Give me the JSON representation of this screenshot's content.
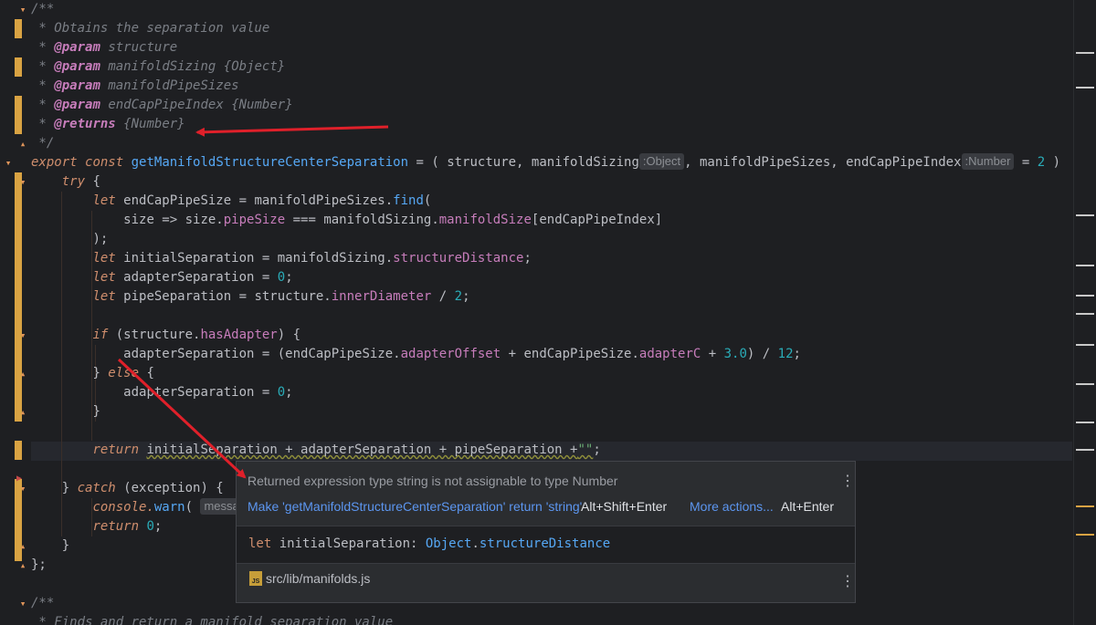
{
  "code": {
    "doc_open": "/**",
    "doc_desc": " * Obtains the separation value",
    "param_tag": "@param",
    "returns_tag": "@returns",
    "p1": "structure",
    "p2": "manifoldSizing",
    "p2_type": "{Object}",
    "p3": "manifoldPipeSizes",
    "p4": "endCapPipeIndex",
    "p4_type": "{Number}",
    "returns_type": "{Number}",
    "doc_close": " */",
    "export_kw": "export",
    "const_kw": "const",
    "func_name": "getManifoldStructureCenterSeparation",
    "sig_start": " = ( structure, manifoldSizing",
    "hint_object": ":Object",
    "sig_mid": ", manifoldPipeSizes, endCapPipeIndex",
    "hint_number": ":Number",
    "sig_end_a": " = ",
    "sig_end_num": "2",
    "sig_end_b": " )",
    "try_kw": "try",
    "let_kw": "let",
    "if_kw": "if",
    "else_kw": "else",
    "return_kw": "return",
    "catch_kw": "catch",
    "l_endcap": " endCapPipeSize = manifoldPipeSizes.",
    "find_fn": "find",
    "l_size": "size => size.",
    "pipeSize": "pipeSize",
    "l_size_b": " === manifoldSizing.",
    "manifoldSize": "manifoldSize",
    "l_size_c": "[endCapPipeIndex]",
    "close_paren": ");",
    "l_init": " initialSeparation = manifoldSizing.",
    "structureDistance": "structureDistance",
    "l_adapter": " adapterSeparation = ",
    "zero": "0",
    "l_pipe": " pipeSeparation = structure.",
    "innerDiameter": "innerDiameter",
    "l_pipe_b": " / ",
    "two": "2",
    "l_if_a": " (structure.",
    "hasAdapter": "hasAdapter",
    "l_if_b": ") {",
    "l_adsep_a": "adapterSeparation = (endCapPipeSize.",
    "adapterOffset": "adapterOffset",
    "l_adsep_b": " + endCapPipeSize.",
    "adapterC": "adapterC",
    "l_adsep_c": " + ",
    "three": "3.0",
    "l_adsep_d": ") / ",
    "twelve": "12",
    "l_else_a": "} ",
    "l_else_b": " {",
    "l_adsep0": "adapterSeparation = ",
    "close_brace": "}",
    "return_expr": "initialSeparation + adapterSeparation + pipeSeparation +",
    "empty_str": "\"\"",
    "catch_a": "} ",
    "catch_b": " (exception) {",
    "console_a": "console.",
    "warn_fn": "warn",
    "console_b": "( ",
    "console_hint": "messa",
    "return_zero_num": "0",
    "close_all": "};",
    "doc2_open": "/**",
    "doc2_desc": " * Finds and return a manifold separation value"
  },
  "popup": {
    "message": "Returned expression type string is not assignable to type Number",
    "fix_label": "Make 'getManifoldStructureCenterSeparation' return 'string'",
    "fix_shortcut": "Alt+Shift+Enter",
    "more_label": "More actions...",
    "more_shortcut": "Alt+Enter",
    "decl_let": "let",
    "decl_name": " initialSeparation: ",
    "decl_type": "Object",
    "decl_dot": ".",
    "decl_member": "structureDistance",
    "file_icon_label": "JS",
    "file": "src/lib/manifolds.js"
  },
  "icons": {
    "fold": "fold-arrow-icon",
    "breakpoint": "breakpoint-icon",
    "kebab": "kebab-menu-icon",
    "file": "js-file-icon"
  },
  "colors": {
    "background": "#1e1f22",
    "keyword": "#cf8e6d",
    "function": "#56a8f5",
    "property": "#c77dbb",
    "number": "#2aacb8",
    "link": "#5c96f0",
    "annotation_arrow": "#e0202a"
  }
}
